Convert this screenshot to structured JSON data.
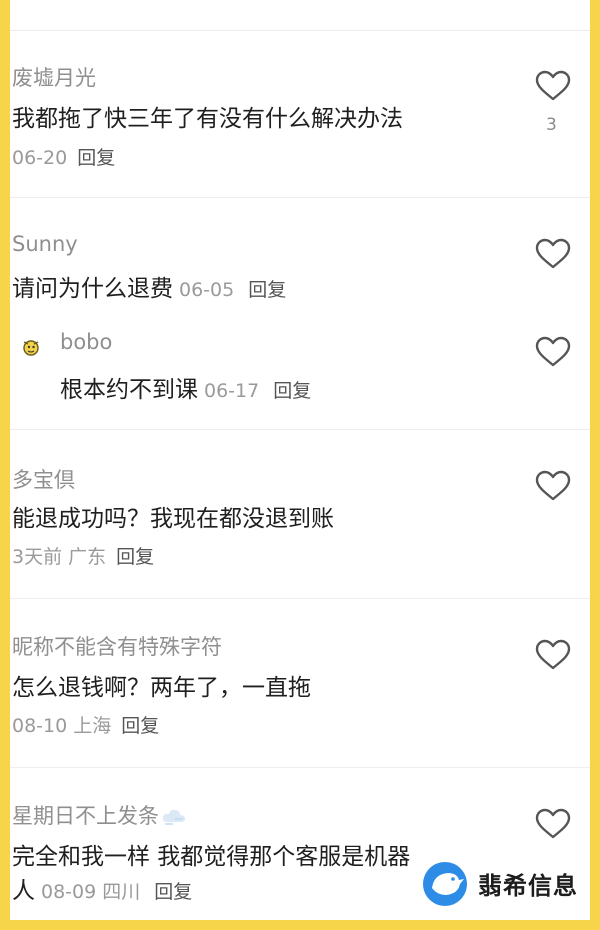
{
  "comments": [
    {
      "author": "废墟月光",
      "text": "我都拖了快三年了有没有什么解决办法",
      "meta": "06-20",
      "reply_label": "回复",
      "likes": "3"
    },
    {
      "author": "Sunny",
      "text": "请问为什么退费",
      "meta": "06-05",
      "reply_label": "回复",
      "replies": [
        {
          "author": "bobo",
          "text": "根本约不到课",
          "meta": "06-17",
          "reply_label": "回复"
        }
      ]
    },
    {
      "author": "多宝倶",
      "text": "能退成功吗？我现在都没退到账",
      "meta": "3天前 广东",
      "reply_label": "回复"
    },
    {
      "author": "昵称不能含有特殊字符",
      "text": "怎么退钱啊？两年了，一直拖",
      "meta": "08-10 上海",
      "reply_label": "回复"
    },
    {
      "author": "星期日不上发条",
      "text_line1": "完全和我一样 我都觉得那个客服是机器",
      "text_line2": "人",
      "meta": "08-09 四川",
      "reply_label": "回复"
    }
  ],
  "watermark": {
    "text": "翡希信息"
  },
  "icons": {
    "like": "heart-outline-icon",
    "avatar": "cartoon-avatar-icon",
    "cloud": "cloud-emoji-icon",
    "logo": "bird-logo-icon"
  },
  "colors": {
    "frame_border": "#f7d54a",
    "author": "#8f8f8f",
    "text": "#1f1f1f",
    "meta": "#9a9a9a",
    "watermark_logo": "#2d8de6"
  }
}
